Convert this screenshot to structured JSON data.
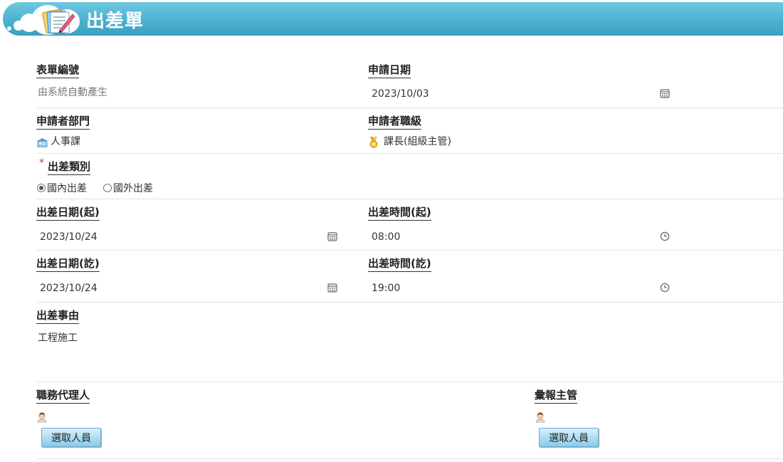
{
  "header": {
    "title": "出差單"
  },
  "form": {
    "form_no": {
      "label": "表單編號",
      "value": "由系統自動產生"
    },
    "apply_date": {
      "label": "申請日期",
      "value": "2023/10/03"
    },
    "dept": {
      "label": "申請者部門",
      "value": "人事課"
    },
    "rank": {
      "label": "申請者職級",
      "value": "課長(組級主管)"
    },
    "trip_type": {
      "required_mark": "*",
      "label": "出差類別",
      "options": [
        {
          "label": "國內出差",
          "selected": true
        },
        {
          "label": "國外出差",
          "selected": false
        }
      ]
    },
    "start_date": {
      "label": "出差日期(起)",
      "value": "2023/10/24"
    },
    "start_time": {
      "label": "出差時間(起)",
      "value": "08:00"
    },
    "end_date": {
      "label": "出差日期(訖)",
      "value": "2023/10/24"
    },
    "end_time": {
      "label": "出差時間(訖)",
      "value": "19:00"
    },
    "reason": {
      "label": "出差事由",
      "value": "工程施工"
    },
    "agent": {
      "label": "職務代理人",
      "button": "選取人員"
    },
    "supervisor": {
      "label": "彙報主管",
      "button": "選取人員"
    }
  }
}
